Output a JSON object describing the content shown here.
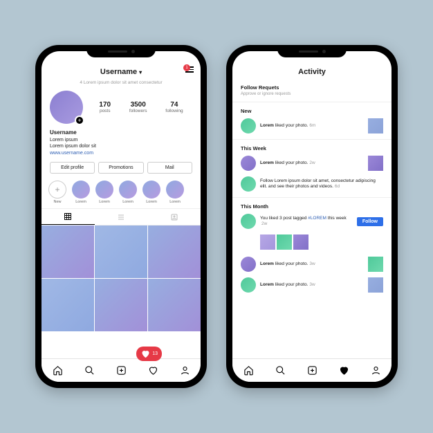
{
  "phone1": {
    "header": {
      "username": "Username",
      "notification_count": "1"
    },
    "sub": "4 Lorem ipsum dolor sit amet consectetur",
    "stats": {
      "posts": {
        "value": "170",
        "label": "posts"
      },
      "followers": {
        "value": "3500",
        "label": "followers"
      },
      "following": {
        "value": "74",
        "label": "following"
      }
    },
    "bio": {
      "name": "Username",
      "line1": "Lorem ipsum",
      "line2": "Lorem ipsum dolor sit",
      "link": "www.username.com"
    },
    "buttons": {
      "edit": "Edit profile",
      "promo": "Promotions",
      "mail": "Mail"
    },
    "stories": [
      "New",
      "Lorem",
      "Lorem",
      "Lorem",
      "Lorem",
      "Lorem"
    ],
    "like_popup": "13"
  },
  "phone2": {
    "title": "Activity",
    "follow_requests": {
      "title": "Follow Requets",
      "sub": "Approve or ignore requests"
    },
    "sections": {
      "new": "New",
      "this_week": "This Week",
      "this_month": "This Month"
    },
    "rows": {
      "r1": {
        "user": "Lorem",
        "text": " liked your photo.",
        "time": "6m"
      },
      "r2": {
        "user": "Lorem",
        "text": " liked your photo.",
        "time": "2w"
      },
      "r3": {
        "text": "Follow Lorem ipsum dolor sit amet, consectetur adipiscing elit. and see their photos and videos.",
        "time": "6d"
      },
      "r4": {
        "text_a": "You liked 3 post tagged ",
        "tag": "#LOREM",
        "text_b": " this week ",
        "time": "2w"
      },
      "r5": {
        "user": "Lorem",
        "text": " liked your photo.",
        "time": "3w"
      },
      "r6": {
        "user": "Lorem",
        "text": " liked your photo.",
        "time": "3w"
      }
    },
    "follow_btn": "Follow"
  }
}
